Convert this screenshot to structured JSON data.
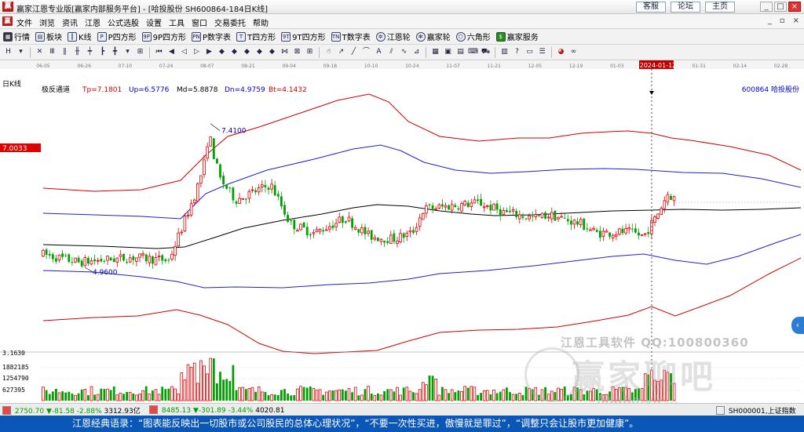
{
  "window": {
    "logo": "赢",
    "title": "赢家江恩专业版[赢家内部服务平台] - [哈投股份  SH600864-184日K线]",
    "links": [
      "客服",
      "论坛",
      "主页"
    ],
    "controls": [
      "_",
      "□",
      "×"
    ]
  },
  "menubar": {
    "items": [
      "文件",
      "浏览",
      "资讯",
      "江恩",
      "公式选股",
      "设置",
      "工具",
      "窗口",
      "交易委托",
      "帮助"
    ],
    "mdi_controls": [
      "_",
      "▫",
      "×"
    ]
  },
  "toolbar1": [
    {
      "label": "行情",
      "icon": "grid-icon"
    },
    {
      "label": "板块",
      "icon": "block-icon"
    },
    {
      "label": "K线",
      "icon": "kline-icon"
    },
    {
      "label": "P四方形",
      "icon": "p-square-icon"
    },
    {
      "label": "9P四方形",
      "icon": "9p-square-icon"
    },
    {
      "label": "P数字表",
      "icon": "p-table-icon"
    },
    {
      "label": "T四方形",
      "icon": "t-square-icon"
    },
    {
      "label": "9T四方形",
      "icon": "9t-square-icon"
    },
    {
      "label": "T数字表",
      "icon": "t-table-icon"
    },
    {
      "label": "江恩轮",
      "icon": "gann-wheel-icon"
    },
    {
      "label": "赢家轮",
      "icon": "winner-wheel-icon"
    },
    {
      "label": "六角形",
      "icon": "hexagon-icon"
    },
    {
      "label": "赢家服务",
      "icon": "service-icon"
    }
  ],
  "chart": {
    "period_label": "日K线",
    "indicator_name": "极反通道",
    "indicator_values": [
      {
        "text": "Tp=7.1801",
        "color": "#cc0000"
      },
      {
        "text": "Up=6.5776",
        "color": "#0000cc"
      },
      {
        "text": "Md=5.8878",
        "color": "#000000"
      },
      {
        "text": "Dn=4.9759",
        "color": "#0000cc"
      },
      {
        "text": "Bt=4.1432",
        "color": "#cc0000"
      }
    ],
    "stock_label": "600864  哈投股份",
    "price_marker": "7.0033",
    "high_annotation": "7.4100",
    "low_annotation": "4.9600",
    "cursor_date": "2024-01-12",
    "volume_ticks": [
      "3.1630",
      "1882185",
      "1254790",
      "627395"
    ],
    "colors": {
      "up": "#e00000",
      "down": "#00a000",
      "upper_band": "#d00000",
      "mid_band": "#2020cc",
      "center": "#000000",
      "volume_up": "#e00000",
      "volume_down": "#00a000"
    }
  },
  "watermark": {
    "line1": "江恩工具软件  QQ:100800360",
    "line2": "赢家聊吧",
    "line3": "liaoba.vic..."
  },
  "chart_data": {
    "type": "candlestick",
    "x_dates": [
      "06-05",
      "06-26",
      "07-10",
      "07-24",
      "08-07",
      "08-21",
      "09-04",
      "09-18",
      "10-10",
      "10-24",
      "11-07",
      "11-21",
      "12-05",
      "12-19",
      "01-03",
      "2024-01-12",
      "01-31",
      "02-14",
      "02-28"
    ],
    "title": "",
    "ylabel": "",
    "price_range": [
      3.6,
      8.0
    ],
    "marks": {
      "high": 7.41,
      "low": 4.96,
      "current_level": 7.0033
    },
    "series": [
      {
        "name": "Tp",
        "last": 7.1801
      },
      {
        "name": "Up",
        "last": 6.5776
      },
      {
        "name": "Md",
        "last": 5.8878
      },
      {
        "name": "Dn",
        "last": 4.9759
      },
      {
        "name": "Bt",
        "last": 4.1432
      }
    ],
    "volume_ticks": [
      627395,
      1254790,
      1882185
    ]
  },
  "statusbar": {
    "sh_index": "2750.70",
    "sh_change": "▼-81.58",
    "sh_pct": "-2.88%",
    "sh_amount": "3312.93亿",
    "sz_index": "8485.13",
    "sz_change": "▼-301.89",
    "sz_pct": "-3.44%",
    "sz_amount": "4020.81",
    "right_label": "SH000001,上证指数"
  },
  "quote": "江恩经典语录：“图表能反映出一切股市或公司股民的总体心理状况”，“不要一次性买进，傲慢就是罪过”，“调整只会让股市更加健康”。"
}
